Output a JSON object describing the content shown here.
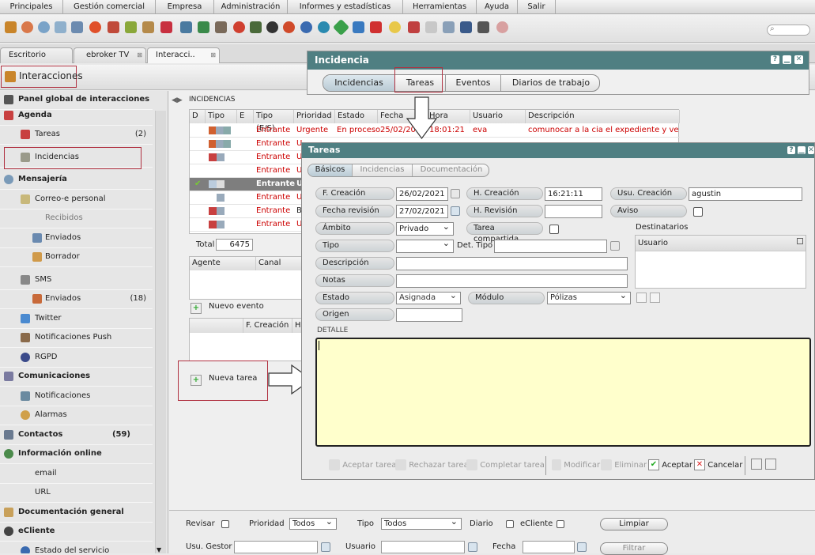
{
  "menubar": [
    "Principales",
    "Gestión comercial",
    "Empresa",
    "Administración",
    "Informes y estadísticas",
    "Herramientas",
    "Ayuda",
    "Salir"
  ],
  "tabs": [
    "Escritorio",
    "ebroker TV",
    "Interacci.."
  ],
  "header": {
    "title": "Interacciones"
  },
  "sidebar": {
    "items": [
      {
        "label": "Panel global de interacciones",
        "bold": true,
        "count": ""
      },
      {
        "label": "Agenda",
        "bold": true,
        "count": ""
      },
      {
        "label": "Tareas",
        "bold": false,
        "count": "(2)"
      },
      {
        "label": "Incidencias",
        "bold": false,
        "count": ""
      },
      {
        "label": "Mensajería",
        "bold": true,
        "count": ""
      },
      {
        "label": "Correo-e personal",
        "bold": false,
        "count": ""
      },
      {
        "label": "Recibidos",
        "bold": false,
        "count": ""
      },
      {
        "label": "Enviados",
        "bold": false,
        "count": ""
      },
      {
        "label": "Borrador",
        "bold": false,
        "count": ""
      },
      {
        "label": "SMS",
        "bold": false,
        "count": ""
      },
      {
        "label": "Enviados",
        "bold": false,
        "count": "(18)"
      },
      {
        "label": "Twitter",
        "bold": false,
        "count": ""
      },
      {
        "label": "Notificaciones Push",
        "bold": false,
        "count": ""
      },
      {
        "label": "RGPD",
        "bold": false,
        "count": ""
      },
      {
        "label": "Comunicaciones",
        "bold": true,
        "count": ""
      },
      {
        "label": "Notificaciones",
        "bold": false,
        "count": ""
      },
      {
        "label": "Alarmas",
        "bold": false,
        "count": ""
      },
      {
        "label": "Contactos",
        "bold": true,
        "count": "(59)"
      },
      {
        "label": "Información online",
        "bold": true,
        "count": ""
      },
      {
        "label": "email",
        "bold": false,
        "count": ""
      },
      {
        "label": "URL",
        "bold": false,
        "count": ""
      },
      {
        "label": "Documentación general",
        "bold": true,
        "count": ""
      },
      {
        "label": "eCliente",
        "bold": true,
        "count": ""
      },
      {
        "label": "Estado del servicio",
        "bold": false,
        "count": ""
      }
    ]
  },
  "incidencias": {
    "section_title": "INCIDENCIAS",
    "columns": [
      "D",
      "Tipo",
      "E",
      "Tipo (E/S)",
      "Prioridad",
      "Estado",
      "Fecha",
      "Hora",
      "Usuario",
      "Descripción"
    ],
    "rows": [
      {
        "tipo_es": "Entrante",
        "prioridad": "Urgente",
        "estado": "En proceso",
        "fecha": "25/02/20",
        "hora": "18:01:21",
        "usuario": "eva",
        "descripcion": "comunocar a la cia el expediente y ver co"
      },
      {
        "tipo_es": "Entrante",
        "prioridad": "U",
        "estado": "",
        "fecha": "",
        "hora": "",
        "usuario": "",
        "descripcion": ""
      },
      {
        "tipo_es": "Entrante",
        "prioridad": "U",
        "estado": "",
        "fecha": "",
        "hora": "",
        "usuario": "",
        "descripcion": ""
      },
      {
        "tipo_es": "Entrante",
        "prioridad": "U",
        "estado": "",
        "fecha": "",
        "hora": "",
        "usuario": "",
        "descripcion": ""
      },
      {
        "tipo_es": "Entrante",
        "prioridad": "U",
        "estado": "",
        "fecha": "",
        "hora": "",
        "usuario": "",
        "descripcion": ""
      },
      {
        "tipo_es": "Entrante",
        "prioridad": "U",
        "estado": "",
        "fecha": "",
        "hora": "",
        "usuario": "",
        "descripcion": ""
      },
      {
        "tipo_es": "Entrante",
        "prioridad": "B",
        "estado": "",
        "fecha": "",
        "hora": "",
        "usuario": "",
        "descripcion": ""
      },
      {
        "tipo_es": "Entrante",
        "prioridad": "U",
        "estado": "",
        "fecha": "",
        "hora": "",
        "usuario": "",
        "descripcion": ""
      }
    ],
    "total_label": "Total",
    "total_value": "6475",
    "agent_cols": [
      "Agente",
      "Canal"
    ],
    "nuevo_evento": "Nuevo evento",
    "task_cols": [
      "F. Creación",
      "H"
    ],
    "nueva_tarea": "Nueva tarea"
  },
  "filters": {
    "revisar": "Revisar",
    "prioridad": "Prioridad",
    "prioridad_value": "Todos",
    "tipo": "Tipo",
    "tipo_value": "Todos",
    "diario": "Diario",
    "ecliente": "eCliente",
    "limpiar": "Limpiar",
    "usu_gestor": "Usu. Gestor",
    "usuario": "Usuario",
    "fecha": "Fecha",
    "filtrar": "Filtrar"
  },
  "incidencia_window": {
    "title": "Incidencia",
    "tabs": [
      "Incidencias",
      "Tareas",
      "Eventos",
      "Diarios de trabajo"
    ]
  },
  "tareas_window": {
    "title": "Tareas",
    "tabs": [
      "Básicos",
      "Incidencias",
      "Documentación"
    ],
    "f_creacion_label": "F. Creación",
    "f_creacion": "26/02/2021",
    "h_creacion_label": "H. Creación",
    "h_creacion": "16:21:11",
    "usu_creacion_label": "Usu. Creación",
    "usu_creacion": "agustin",
    "fecha_revision_label": "Fecha revisión",
    "fecha_revision": "27/02/2021",
    "h_revision_label": "H. Revisión",
    "aviso_label": "Aviso",
    "ambito_label": "Ámbito",
    "ambito": "Privado",
    "tarea_compartida_label": "Tarea compartida",
    "destinatarios_label": "Destinatarios",
    "usuario_col": "Usuario",
    "tipo_label": "Tipo",
    "det_tipo_label": "Det. Tipo",
    "descripcion_label": "Descripción",
    "notas_label": "Notas",
    "estado_label": "Estado",
    "estado": "Asignada",
    "modulo_label": "Módulo",
    "modulo": "Pólizas",
    "origen_label": "Origen",
    "detalle_label": "DETALLE",
    "footer": {
      "aceptar_tarea": "Aceptar tarea",
      "rechazar_tarea": "Rechazar tarea",
      "completar_tarea": "Completar tarea",
      "modificar": "Modificar",
      "eliminar": "Eliminar",
      "aceptar": "Aceptar",
      "cancelar": "Cancelar"
    }
  },
  "colors": {
    "titlebar": "#4f7f82",
    "detalle_bg": "#ffffcc",
    "red_text": "#cc0000",
    "highlight": "#b03040"
  }
}
